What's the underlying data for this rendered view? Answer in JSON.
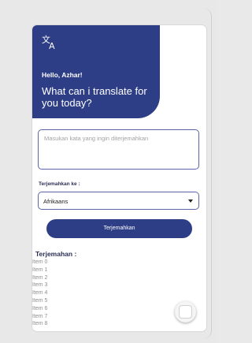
{
  "header": {
    "icon": "translate-icon",
    "greeting": "Hello, Azhar!",
    "headline": "What can i translate for you today?"
  },
  "input": {
    "placeholder": "Masukan kata yang ingin diterjemahkan"
  },
  "language": {
    "label": "Terjemahkan ke :",
    "selected": "Afrikaans"
  },
  "translate_button": {
    "label": "Terjemahkan"
  },
  "result": {
    "title": "Terjemahan :",
    "items": [
      "Item 0",
      "Item 1",
      "Item 2",
      "Item 3",
      "Item 4",
      "Item 5",
      "Item 6",
      "Item 7",
      "Item 8"
    ]
  },
  "colors": {
    "primary": "#2e3e86",
    "border": "#5a64a8",
    "muted_text": "#8f8f8f"
  }
}
